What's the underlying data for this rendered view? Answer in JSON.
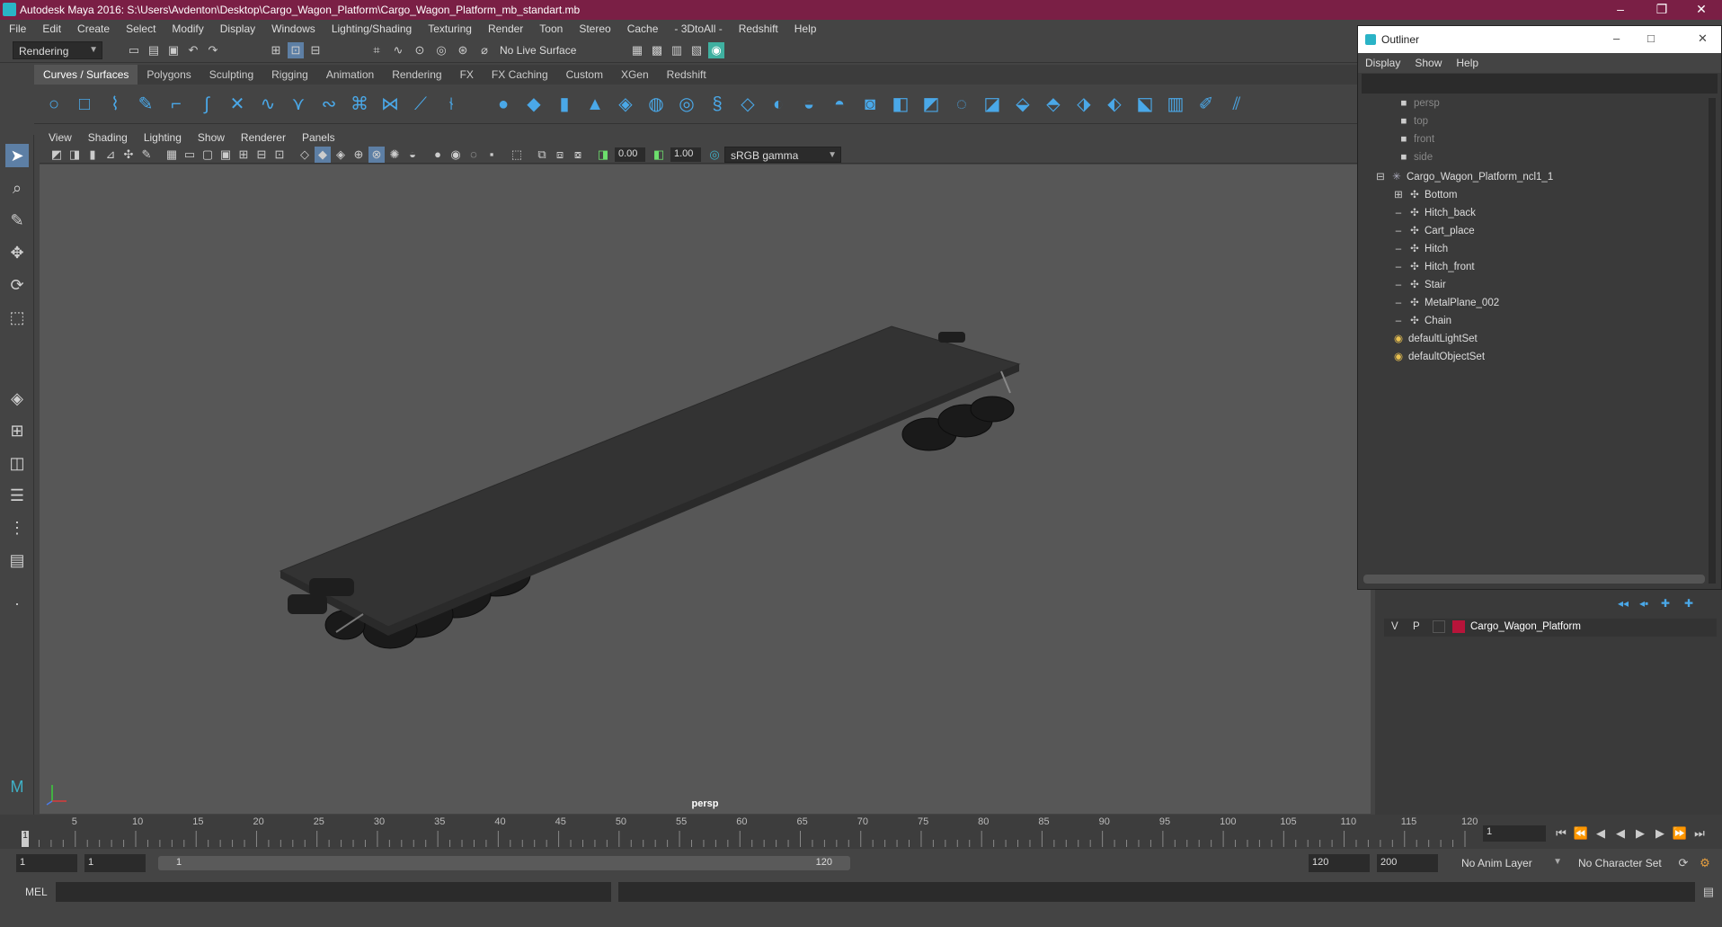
{
  "window": {
    "title": "Autodesk Maya 2016: S:\\Users\\Avdenton\\Desktop\\Cargo_Wagon_Platform\\Cargo_Wagon_Platform_mb_standart.mb",
    "accent": "#7a1f45",
    "controls": [
      "–",
      "❐",
      "✕"
    ]
  },
  "menubar": [
    "File",
    "Edit",
    "Create",
    "Select",
    "Modify",
    "Display",
    "Windows",
    "Lighting/Shading",
    "Texturing",
    "Render",
    "Toon",
    "Stereo",
    "Cache",
    "- 3DtoAll -",
    "Redshift",
    "Help"
  ],
  "statusline": {
    "menu_set": "Rendering",
    "live_surface": "No Live Surface"
  },
  "shelf": {
    "tabs": [
      "Curves / Surfaces",
      "Polygons",
      "Sculpting",
      "Rigging",
      "Animation",
      "Rendering",
      "FX",
      "FX Caching",
      "Custom",
      "XGen",
      "Redshift"
    ],
    "active_tab": "Curves / Surfaces",
    "icon_color": "#4aa8e8"
  },
  "panel": {
    "menu": [
      "View",
      "Shading",
      "Lighting",
      "Show",
      "Renderer",
      "Panels"
    ],
    "exposure": "0.00",
    "gamma": "1.00",
    "color_space": "sRGB gamma",
    "camera_label": "persp"
  },
  "outliner": {
    "title": "Outliner",
    "menu": [
      "Display",
      "Show",
      "Help"
    ],
    "items": [
      {
        "label": "persp",
        "dim": true
      },
      {
        "label": "top",
        "dim": true
      },
      {
        "label": "front",
        "dim": true
      },
      {
        "label": "side",
        "dim": true
      },
      {
        "label": "Cargo_Wagon_Platform_ncl1_1",
        "dim": false
      },
      {
        "label": "Bottom",
        "dim": false
      },
      {
        "label": "Hitch_back",
        "dim": false
      },
      {
        "label": "Cart_place",
        "dim": false
      },
      {
        "label": "Hitch",
        "dim": false
      },
      {
        "label": "Hitch_front",
        "dim": false
      },
      {
        "label": "Stair",
        "dim": false
      },
      {
        "label": "MetalPlane_002",
        "dim": false
      },
      {
        "label": "Chain",
        "dim": false
      },
      {
        "label": "defaultLightSet",
        "dim": false
      },
      {
        "label": "defaultObjectSet",
        "dim": false
      }
    ]
  },
  "layers": {
    "row": {
      "v": "V",
      "p": "P",
      "name": "Cargo_Wagon_Platform",
      "color": "#b8143a"
    }
  },
  "timeline": {
    "ticks": [
      "5",
      "10",
      "15",
      "20",
      "25",
      "30",
      "35",
      "40",
      "45",
      "50",
      "55",
      "60",
      "65",
      "70",
      "75",
      "80",
      "85",
      "90",
      "95",
      "100",
      "105",
      "110",
      "115",
      "120"
    ],
    "current_frame": "1",
    "frame_field": "1"
  },
  "range": {
    "start": "1",
    "start_inner": "1",
    "slider_start": "1",
    "slider_end": "120",
    "end_inner": "120",
    "end": "200",
    "anim_layer": "No Anim Layer",
    "char_set": "No Character Set"
  },
  "cmdline": {
    "label": "MEL"
  }
}
